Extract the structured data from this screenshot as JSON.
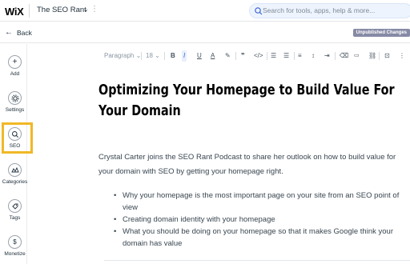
{
  "topbar": {
    "logo": "WiX",
    "site_name": "The SEO Rant",
    "site_chevron": "⌄",
    "search_placeholder": "Search for tools, apps, help & more..."
  },
  "subbar": {
    "back_label": "Back",
    "status_badge": "Unpublished Changes"
  },
  "sidebar": {
    "items": [
      {
        "label": "Add",
        "icon": "plus-icon"
      },
      {
        "label": "Settings",
        "icon": "gear-icon"
      },
      {
        "label": "SEO",
        "icon": "search-icon",
        "highlighted": true
      },
      {
        "label": "Categories",
        "icon": "categories-icon"
      },
      {
        "label": "Tags",
        "icon": "tag-icon"
      },
      {
        "label": "Monetize",
        "icon": "dollar-icon"
      }
    ]
  },
  "toolbar": {
    "paragraph_style": "Paragraph",
    "font_size": "18"
  },
  "document": {
    "title": "Optimizing Your Homepage to Build Value For Your Domain",
    "intro": "Crystal Carter joins the SEO Rant Podcast to share her outlook on how to build value for your domain with SEO by getting your homepage right.",
    "bullets": [
      "Why your homepage is the most important page on your site from an SEO point of view",
      "Creating domain identity with your homepage",
      "What you should be doing on your homepage so that it makes Google think your domain has value"
    ]
  },
  "colors": {
    "highlight": "#f0b826",
    "badge": "#868aa5",
    "search_bg": "#eef4fe"
  }
}
